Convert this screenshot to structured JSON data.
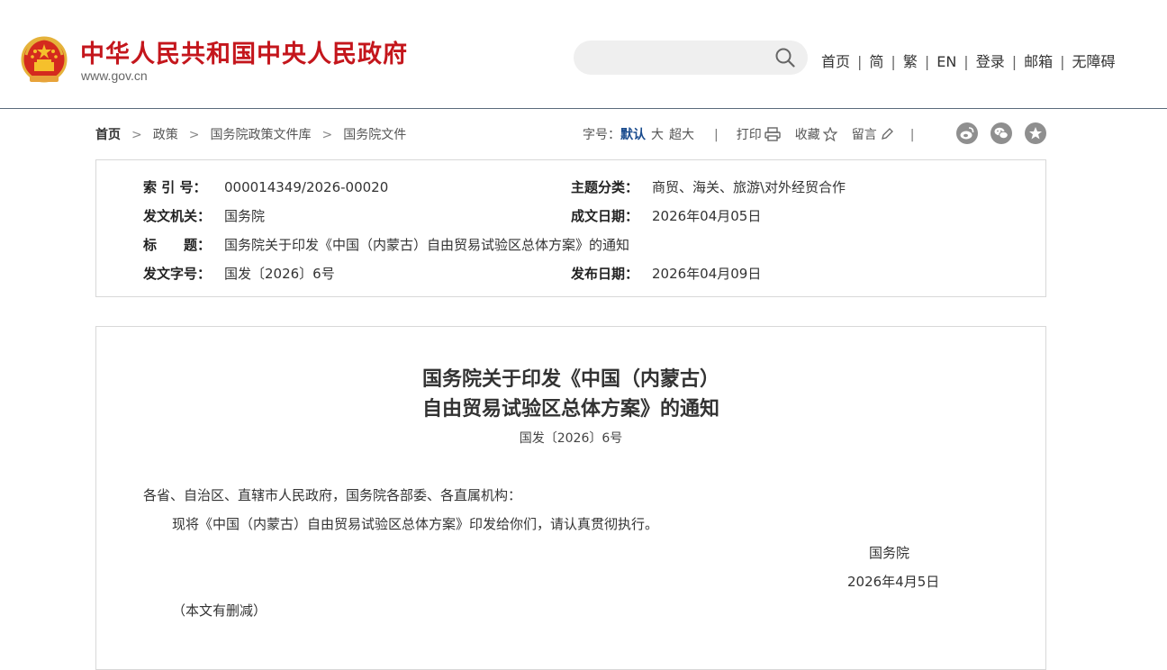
{
  "header": {
    "site_title": "中华人民共和国中央人民政府",
    "site_url": "www.gov.cn",
    "search_placeholder": "",
    "nav": [
      "首页",
      "简",
      "繁",
      "EN",
      "登录",
      "邮箱",
      "无障碍"
    ]
  },
  "breadcrumb": {
    "home": "首页",
    "items": [
      "政策",
      "国务院政策文件库",
      "国务院文件"
    ]
  },
  "tools": {
    "font_size_label": "字号：",
    "size_default": "默认",
    "size_large": "大",
    "size_xlarge": "超大",
    "print": "打印",
    "favorite": "收藏",
    "comment": "留言",
    "divider": "|"
  },
  "share_icons": [
    "weibo-icon",
    "wechat-icon",
    "favorite-star-icon"
  ],
  "meta": {
    "index_label": "索 引 号：",
    "index_value": "000014349/2026-00020",
    "category_label": "主题分类：",
    "category_value": "商贸、海关、旅游\\对外经贸合作",
    "issuer_label": "发文机关：",
    "issuer_value": "国务院",
    "written_date_label": "成文日期：",
    "written_date_value": "2026年04月05日",
    "title_label": "标　　题：",
    "title_value": "国务院关于印发《中国（内蒙古）自由贸易试验区总体方案》的通知",
    "doc_number_label": "发文字号：",
    "doc_number_value": "国发〔2026〕6号",
    "publish_date_label": "发布日期：",
    "publish_date_value": "2026年04月09日"
  },
  "document": {
    "title_line1": "国务院关于印发《中国（内蒙古）",
    "title_line2": "自由贸易试验区总体方案》的通知",
    "number": "国发〔2026〕6号",
    "salutation": "各省、自治区、直辖市人民政府，国务院各部委、各直属机构：",
    "body": "现将《中国（内蒙古）自由贸易试验区总体方案》印发给你们，请认真贯彻执行。",
    "signer": "国务院",
    "date": "2026年4月5日",
    "note": "（本文有删减）"
  },
  "colors": {
    "title_red": "#c4161c",
    "link_blue": "#1a4c8e",
    "border": "#d8d8d8",
    "icon_gray": "#8f8f8f"
  }
}
